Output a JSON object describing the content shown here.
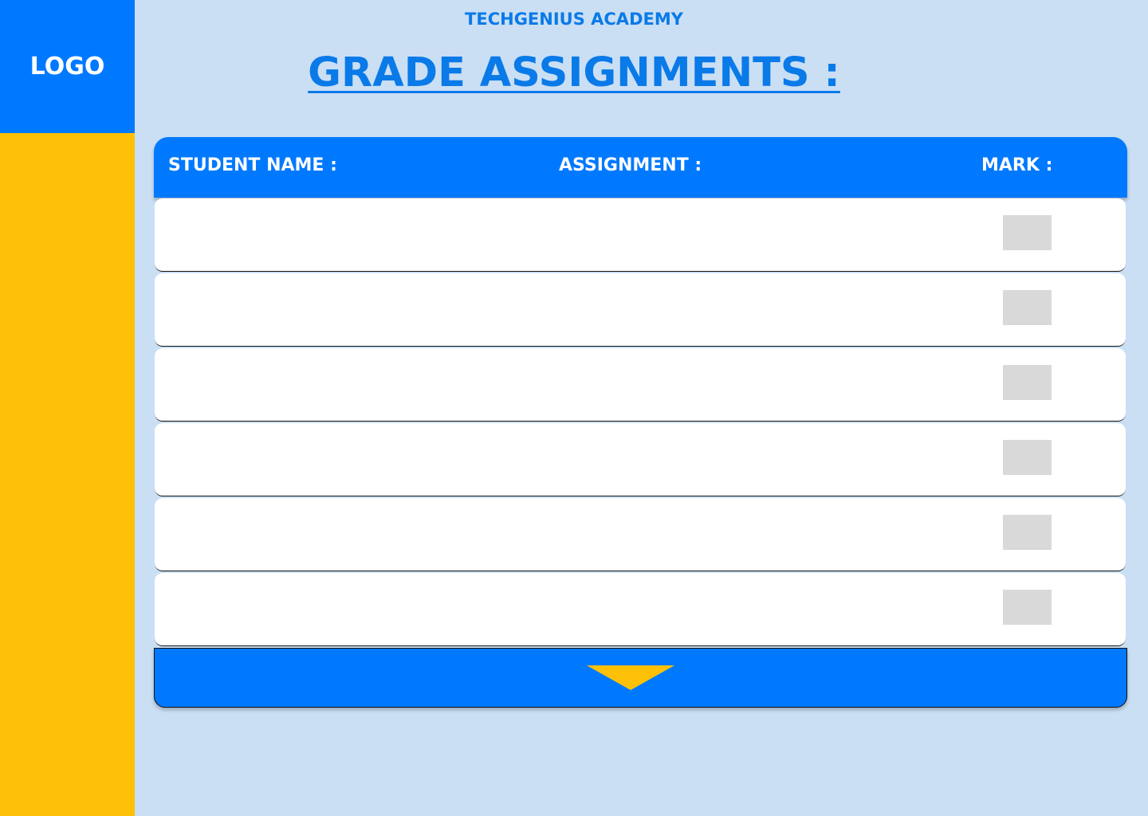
{
  "sidebar": {
    "logo_text": "LOGO"
  },
  "header": {
    "org_name": "TECHGENIUS ACADEMY",
    "page_title": "GRADE ASSIGNMENTS :"
  },
  "table": {
    "columns": {
      "student_name": "STUDENT NAME  :",
      "assignment": "ASSIGNMENT :",
      "mark": "MARK :"
    },
    "rows": [
      {
        "student_name": "",
        "assignment": "",
        "mark": ""
      },
      {
        "student_name": "",
        "assignment": "",
        "mark": ""
      },
      {
        "student_name": "",
        "assignment": "",
        "mark": ""
      },
      {
        "student_name": "",
        "assignment": "",
        "mark": ""
      },
      {
        "student_name": "",
        "assignment": "",
        "mark": ""
      },
      {
        "student_name": "",
        "assignment": "",
        "mark": ""
      }
    ]
  },
  "footer": {
    "icon": "chevron-down-icon"
  },
  "colors": {
    "background": "#cadff4",
    "primary": "#0079ff",
    "accent": "#ffc107",
    "title": "#0a7ae8",
    "mark_box": "#d9d9d9"
  }
}
